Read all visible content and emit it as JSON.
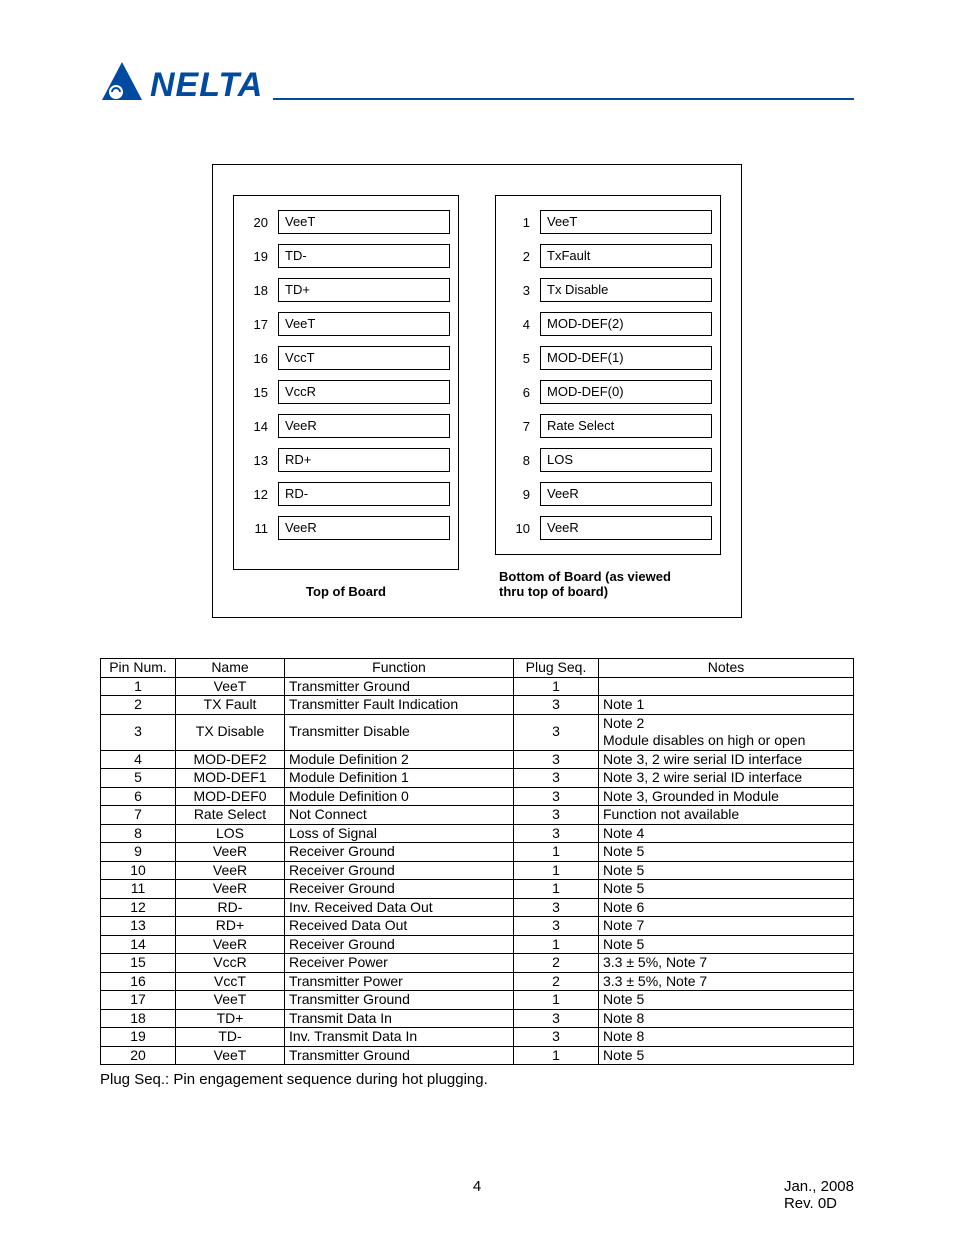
{
  "logo_text": "NELTA",
  "diagram": {
    "left": {
      "pins": [
        {
          "num": "20",
          "label": "VeeT"
        },
        {
          "num": "19",
          "label": "TD-"
        },
        {
          "num": "18",
          "label": "TD+"
        },
        {
          "num": "17",
          "label": "VeeT"
        },
        {
          "num": "16",
          "label": "VccT"
        },
        {
          "num": "15",
          "label": "VccR"
        },
        {
          "num": "14",
          "label": "VeeR"
        },
        {
          "num": "13",
          "label": "RD+"
        },
        {
          "num": "12",
          "label": "RD-"
        },
        {
          "num": "11",
          "label": "VeeR"
        }
      ],
      "caption": "Top of Board"
    },
    "right": {
      "pins": [
        {
          "num": "1",
          "label": "VeeT"
        },
        {
          "num": "2",
          "label": "TxFault"
        },
        {
          "num": "3",
          "label": "Tx Disable"
        },
        {
          "num": "4",
          "label": "MOD-DEF(2)"
        },
        {
          "num": "5",
          "label": "MOD-DEF(1)"
        },
        {
          "num": "6",
          "label": "MOD-DEF(0)"
        },
        {
          "num": "7",
          "label": "Rate Select"
        },
        {
          "num": "8",
          "label": "LOS"
        },
        {
          "num": "9",
          "label": "VeeR"
        },
        {
          "num": "10",
          "label": "VeeR"
        }
      ],
      "caption_line1": "Bottom of Board (as viewed",
      "caption_line2": "thru top of board)"
    }
  },
  "table": {
    "headers": {
      "pin": "Pin Num.",
      "name": "Name",
      "func": "Function",
      "seq": "Plug Seq.",
      "notes": "Notes"
    },
    "rows": [
      {
        "pin": "1",
        "name": "VeeT",
        "func": "Transmitter Ground",
        "seq": "1",
        "notes": ""
      },
      {
        "pin": "2",
        "name": "TX Fault",
        "func": "Transmitter Fault Indication",
        "seq": "3",
        "notes": "Note 1"
      },
      {
        "pin": "3",
        "name": "TX Disable",
        "func": "Transmitter Disable",
        "seq": "3",
        "notes": "Note 2\nModule disables on high or open"
      },
      {
        "pin": "4",
        "name": "MOD-DEF2",
        "func": "Module Definition 2",
        "seq": "3",
        "notes": "Note 3, 2 wire serial ID interface"
      },
      {
        "pin": "5",
        "name": "MOD-DEF1",
        "func": "Module Definition 1",
        "seq": "3",
        "notes": "Note 3, 2 wire serial ID interface"
      },
      {
        "pin": "6",
        "name": "MOD-DEF0",
        "func": "Module Definition 0",
        "seq": "3",
        "notes": "Note 3, Grounded in Module"
      },
      {
        "pin": "7",
        "name": "Rate Select",
        "func": "Not Connect",
        "seq": "3",
        "notes": "Function not available"
      },
      {
        "pin": "8",
        "name": "LOS",
        "func": "Loss of Signal",
        "seq": "3",
        "notes": "Note 4"
      },
      {
        "pin": "9",
        "name": "VeeR",
        "func": "Receiver Ground",
        "seq": "1",
        "notes": "Note 5"
      },
      {
        "pin": "10",
        "name": "VeeR",
        "func": "Receiver Ground",
        "seq": "1",
        "notes": "Note 5"
      },
      {
        "pin": "11",
        "name": "VeeR",
        "func": "Receiver Ground",
        "seq": "1",
        "notes": "Note 5"
      },
      {
        "pin": "12",
        "name": "RD-",
        "func": "Inv. Received Data Out",
        "seq": "3",
        "notes": "Note 6"
      },
      {
        "pin": "13",
        "name": "RD+",
        "func": "Received Data Out",
        "seq": "3",
        "notes": "Note 7"
      },
      {
        "pin": "14",
        "name": "VeeR",
        "func": "Receiver Ground",
        "seq": "1",
        "notes": "Note 5"
      },
      {
        "pin": "15",
        "name": "VccR",
        "func": "Receiver Power",
        "seq": "2",
        "notes": "3.3 ± 5%, Note 7"
      },
      {
        "pin": "16",
        "name": "VccT",
        "func": "Transmitter Power",
        "seq": "2",
        "notes": "3.3 ± 5%, Note 7"
      },
      {
        "pin": "17",
        "name": "VeeT",
        "func": "Transmitter Ground",
        "seq": "1",
        "notes": "Note 5"
      },
      {
        "pin": "18",
        "name": "TD+",
        "func": "Transmit Data In",
        "seq": "3",
        "notes": "Note 8"
      },
      {
        "pin": "19",
        "name": "TD-",
        "func": "Inv. Transmit Data In",
        "seq": "3",
        "notes": "Note 8"
      },
      {
        "pin": "20",
        "name": "VeeT",
        "func": "Transmitter Ground",
        "seq": "1",
        "notes": "Note 5"
      }
    ]
  },
  "plug_note": "Plug Seq.: Pin engagement sequence during hot plugging.",
  "footer": {
    "page_no": "4",
    "date": "Jan.,  2008",
    "rev": "Rev. 0D"
  }
}
